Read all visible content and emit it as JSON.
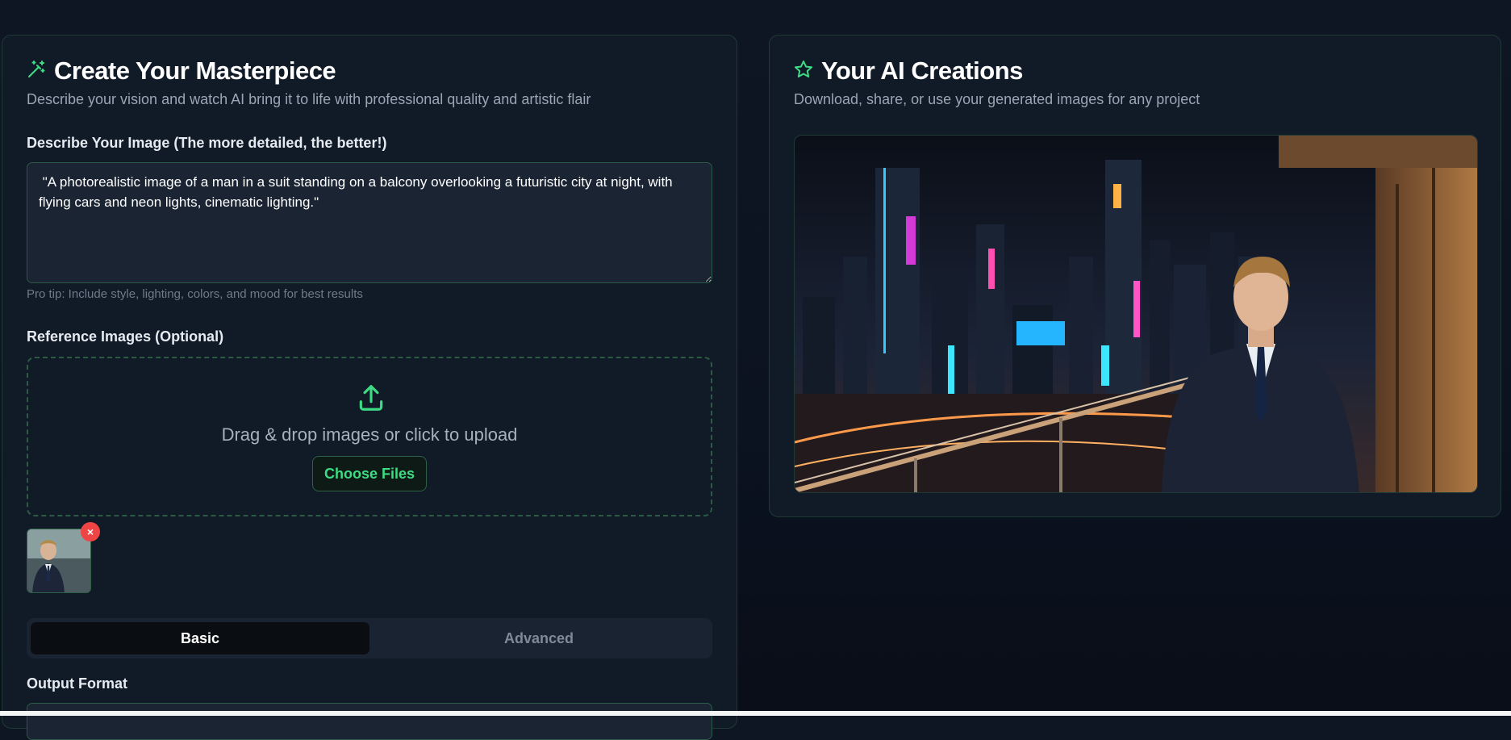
{
  "left_panel": {
    "title": "Create Your Masterpiece",
    "subtitle": "Describe your vision and watch AI bring it to life with professional quality and artistic flair",
    "prompt": {
      "label": "Describe Your Image (The more detailed, the better!)",
      "value": " \"A photorealistic image of a man in a suit standing on a balcony overlooking a futuristic city at night, with flying cars and neon lights, cinematic lighting.\"",
      "tip": "Pro tip: Include style, lighting, colors, and mood for best results"
    },
    "reference": {
      "label": "Reference Images (Optional)",
      "drop_text": "Drag & drop images or click to upload",
      "choose_button": "Choose Files",
      "remove_symbol": "×"
    },
    "tabs": [
      {
        "label": "Basic",
        "active": true
      },
      {
        "label": "Advanced",
        "active": false
      }
    ],
    "output_format_label": "Output Format"
  },
  "right_panel": {
    "title": "Your AI Creations",
    "subtitle": "Download, share, or use your generated images for any project"
  },
  "icons": {
    "left_title_icon": "magic-wand-icon",
    "right_title_icon": "star-icon",
    "upload_icon": "upload-icon",
    "remove_icon": "close-icon"
  },
  "colors": {
    "accent": "#3ddc84",
    "panel_bg": "#111a27",
    "panel_border": "#1f3a36",
    "remove": "#ef4444"
  }
}
